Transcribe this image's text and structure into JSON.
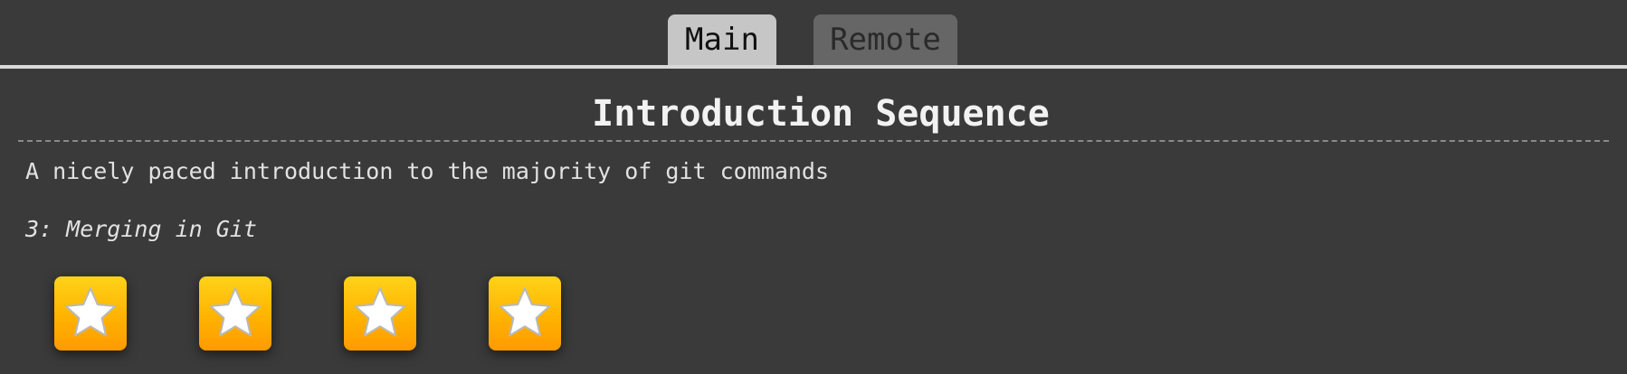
{
  "tabs": {
    "main_label": "Main",
    "remote_label": "Remote"
  },
  "sequence": {
    "title": "Introduction Sequence",
    "description": "A nicely paced introduction to the majority of git commands",
    "current_level": "3: Merging in Git"
  },
  "levels": {
    "count": 4,
    "icon": "star-icon",
    "tile_color": "#ffb300",
    "star_color": "#ffffff"
  },
  "colors": {
    "background": "#3a3a3a",
    "active_tab": "#c6c6c6",
    "inactive_tab": "#666666",
    "text": "#e2e2e2"
  }
}
